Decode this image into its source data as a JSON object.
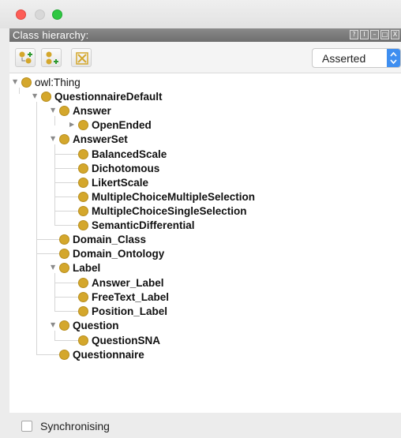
{
  "view": {
    "title": "Class hierarchy:",
    "controls": [
      "?",
      "I",
      "–",
      "□",
      "X"
    ]
  },
  "toolbar": {
    "buttons": [
      "add-subclass-icon",
      "add-sibling-icon",
      "delete-class-icon"
    ],
    "mode": "Asserted"
  },
  "tree": {
    "nodes": [
      {
        "label": "owl:Thing"
      },
      {
        "label": "QuestionnaireDefault"
      },
      {
        "label": "Answer"
      },
      {
        "label": "OpenEnded"
      },
      {
        "label": "AnswerSet"
      },
      {
        "label": "BalancedScale"
      },
      {
        "label": "Dichotomous"
      },
      {
        "label": "LikertScale"
      },
      {
        "label": "MultipleChoiceMultipleSelection"
      },
      {
        "label": "MultipleChoiceSingleSelection"
      },
      {
        "label": "SemanticDifferential"
      },
      {
        "label": "Domain_Class"
      },
      {
        "label": "Domain_Ontology"
      },
      {
        "label": "Label"
      },
      {
        "label": "Answer_Label"
      },
      {
        "label": "FreeText_Label"
      },
      {
        "label": "Position_Label"
      },
      {
        "label": "Question"
      },
      {
        "label": "QuestionSNA"
      },
      {
        "label": "Questionnaire"
      }
    ]
  },
  "footer": {
    "sync_label": "Synchronising"
  },
  "colors": {
    "class_bullet": "#d4a72c",
    "mode_arrow": "#3e8ef0"
  }
}
